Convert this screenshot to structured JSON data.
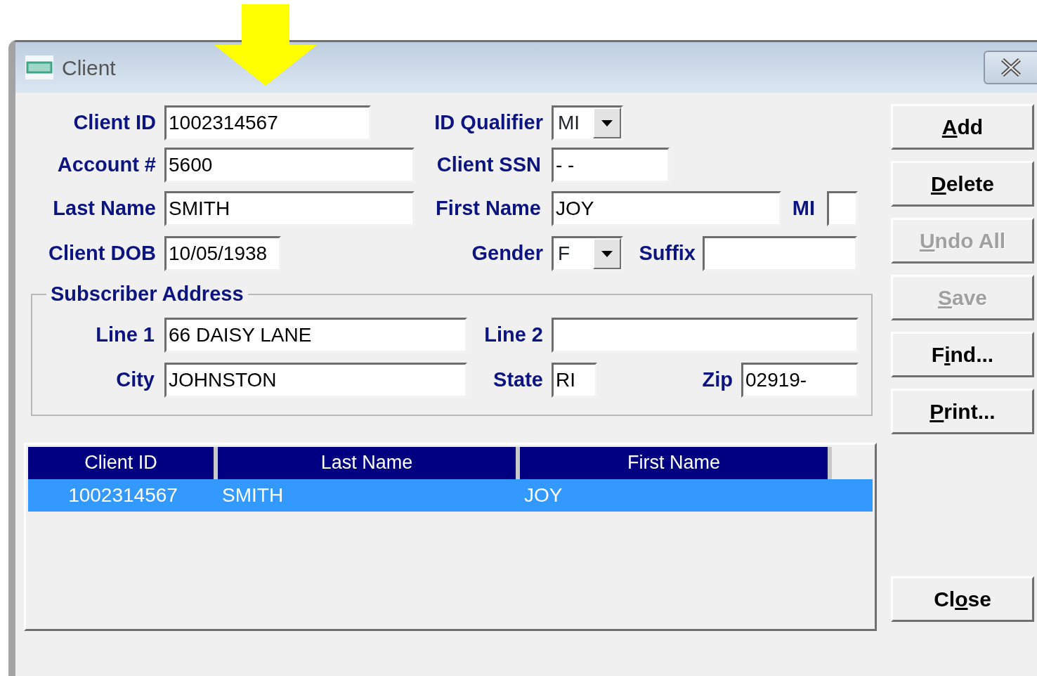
{
  "window": {
    "title": "Client"
  },
  "client_form": {
    "rows": [
      [
        {
          "kind": "label",
          "text": "Client ID"
        },
        {
          "kind": "text",
          "value": "1002314567"
        },
        {
          "kind": "label",
          "text": "ID Qualifier"
        },
        {
          "kind": "select",
          "value": "MI"
        }
      ],
      [
        {
          "kind": "label",
          "text": "Account #"
        },
        {
          "kind": "text",
          "value": "5600"
        },
        {
          "kind": "label",
          "text": "Client SSN"
        },
        {
          "kind": "text",
          "value": "- -"
        }
      ],
      [
        {
          "kind": "label",
          "text": "Last Name"
        },
        {
          "kind": "text",
          "value": "SMITH"
        },
        {
          "kind": "label",
          "text": "First Name"
        },
        {
          "kind": "text",
          "value": "JOY"
        },
        {
          "kind": "label",
          "text": "MI"
        },
        {
          "kind": "text"
        }
      ],
      [
        {
          "kind": "label",
          "text": "Client DOB"
        },
        {
          "kind": "text",
          "value": "10/05/1938"
        },
        {
          "kind": "label",
          "text": "Gender"
        },
        {
          "kind": "select",
          "value": "F"
        },
        {
          "kind": "label",
          "text": "Suffix"
        },
        {
          "kind": "text"
        }
      ]
    ]
  },
  "subscriber_address": {
    "legend": "Subscriber Address",
    "rows": [
      [
        {
          "kind": "label",
          "text": "Line 1"
        },
        {
          "kind": "text",
          "value": "66 DAISY LANE"
        },
        {
          "kind": "label",
          "text": "Line 2"
        },
        {
          "kind": "text"
        }
      ],
      [
        {
          "kind": "label",
          "text": "City"
        },
        {
          "kind": "text",
          "value": "JOHNSTON"
        },
        {
          "kind": "label",
          "text": "State"
        },
        {
          "kind": "text",
          "value": "RI"
        },
        {
          "kind": "label",
          "text": "Zip"
        },
        {
          "kind": "text",
          "value": "02919-"
        }
      ]
    ]
  },
  "results_table": {
    "columns": [
      "Client ID",
      "Last Name",
      "First Name"
    ],
    "rows": [
      {
        "cells": [
          "1002314567",
          "SMITH",
          "JOY"
        ],
        "selected": true
      }
    ]
  },
  "buttons": [
    {
      "access_key": "A",
      "after": "dd",
      "disabled": false
    },
    {
      "access_key": "D",
      "after": "elete",
      "disabled": false
    },
    {
      "access_key": "U",
      "after": "ndo All",
      "disabled": true
    },
    {
      "access_key": "S",
      "after": "ave",
      "disabled": true
    },
    {
      "before": "F",
      "access_key": "i",
      "after": "nd...",
      "disabled": false
    },
    {
      "access_key": "P",
      "after": "rint...",
      "disabled": false
    }
  ],
  "close_button": {
    "before": "Cl",
    "access_key": "o",
    "after": "se",
    "disabled": false
  }
}
